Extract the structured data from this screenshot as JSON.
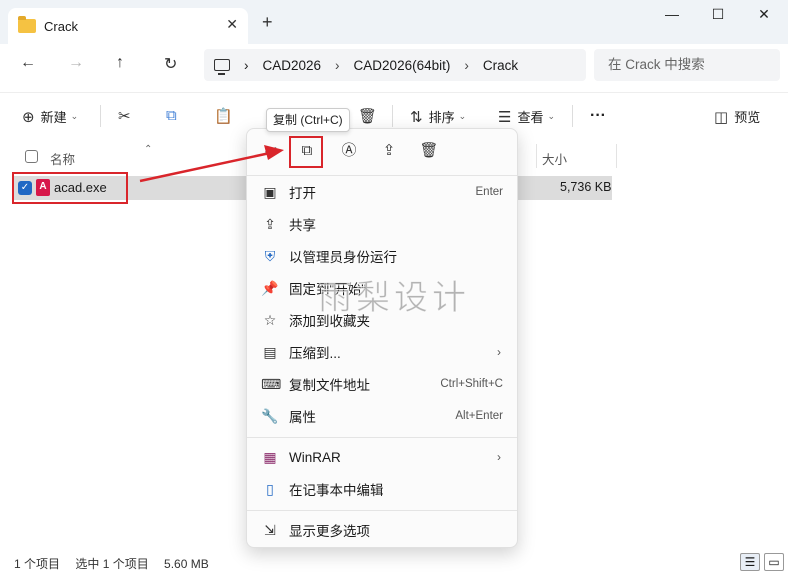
{
  "tab": {
    "title": "Crack",
    "close": "✕",
    "new_tab": "+"
  },
  "window_controls": {
    "minimize": "—",
    "maximize": "☐",
    "close": "✕"
  },
  "nav": {
    "back": "←",
    "forward": "→",
    "up": "↑",
    "refresh": "↻"
  },
  "breadcrumb": [
    "CAD2026",
    "CAD2026(64bit)",
    "Crack"
  ],
  "breadcrumb_sep": "›",
  "search": {
    "placeholder": "在 Crack 中搜索"
  },
  "toolbar": {
    "new_label": "新建",
    "sort_label": "排序",
    "view_label": "查看",
    "more": "···",
    "preview_label": "预览"
  },
  "columns": {
    "name": "名称",
    "size": "大小"
  },
  "file": {
    "name": "acad.exe",
    "size": "5,736 KB",
    "icon_letter": "A"
  },
  "tooltip": "复制 (Ctrl+C)",
  "context_menu": {
    "items": [
      {
        "label": "打开",
        "shortcut": "Enter"
      },
      {
        "label": "共享",
        "shortcut": ""
      },
      {
        "label": "以管理员身份运行",
        "shortcut": ""
      },
      {
        "label": "固定到\"开始\"",
        "shortcut": ""
      },
      {
        "label": "添加到收藏夹",
        "shortcut": ""
      },
      {
        "label": "压缩到...",
        "shortcut": ""
      },
      {
        "label": "复制文件地址",
        "shortcut": "Ctrl+Shift+C"
      },
      {
        "label": "属性",
        "shortcut": "Alt+Enter"
      },
      {
        "label": "WinRAR",
        "shortcut": ""
      },
      {
        "label": "在记事本中编辑",
        "shortcut": ""
      },
      {
        "label": "显示更多选项",
        "shortcut": ""
      }
    ]
  },
  "status": {
    "count": "1 个项目",
    "selected": "选中 1 个项目",
    "size": "5.60 MB"
  },
  "watermark": "雨梨设计",
  "colors": {
    "accent": "#2168c4",
    "highlight_red": "#d9252b",
    "selected_row": "#dcdcdc"
  }
}
